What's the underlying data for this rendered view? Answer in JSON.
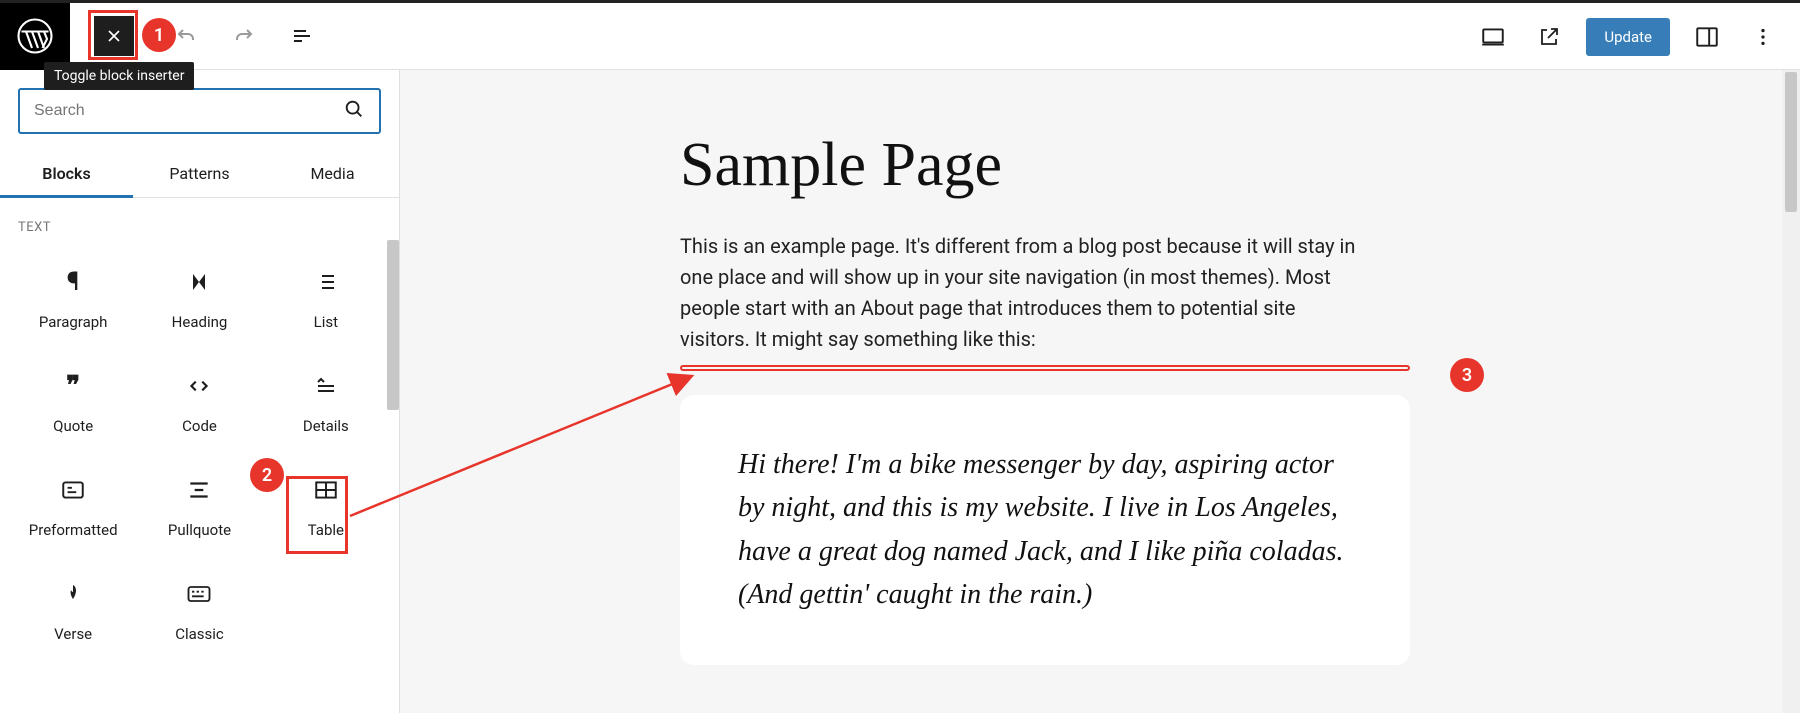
{
  "tooltip": "Toggle block inserter",
  "search": {
    "placeholder": "Search"
  },
  "tabs": {
    "blocks": "Blocks",
    "patterns": "Patterns",
    "media": "Media"
  },
  "category_label": "TEXT",
  "blocks": {
    "paragraph": "Paragraph",
    "heading": "Heading",
    "list": "List",
    "quote": "Quote",
    "code": "Code",
    "details": "Details",
    "preformatted": "Preformatted",
    "pullquote": "Pullquote",
    "table": "Table",
    "verse": "Verse",
    "classic": "Classic"
  },
  "toolbar": {
    "update": "Update"
  },
  "page": {
    "title": "Sample Page",
    "paragraph": "This is an example page. It's different from a blog post because it will stay in one place and will show up in your site navigation (in most themes). Most people start with an About page that introduces them to potential site visitors. It might say something like this:",
    "quote": "Hi there! I'm a bike messenger by day, aspiring actor by night, and this is my website. I live in Los Angeles, have a great dog named Jack, and I like piña coladas. (And gettin' caught in the rain.)"
  },
  "annotations": {
    "one": "1",
    "two": "2",
    "three": "3"
  }
}
